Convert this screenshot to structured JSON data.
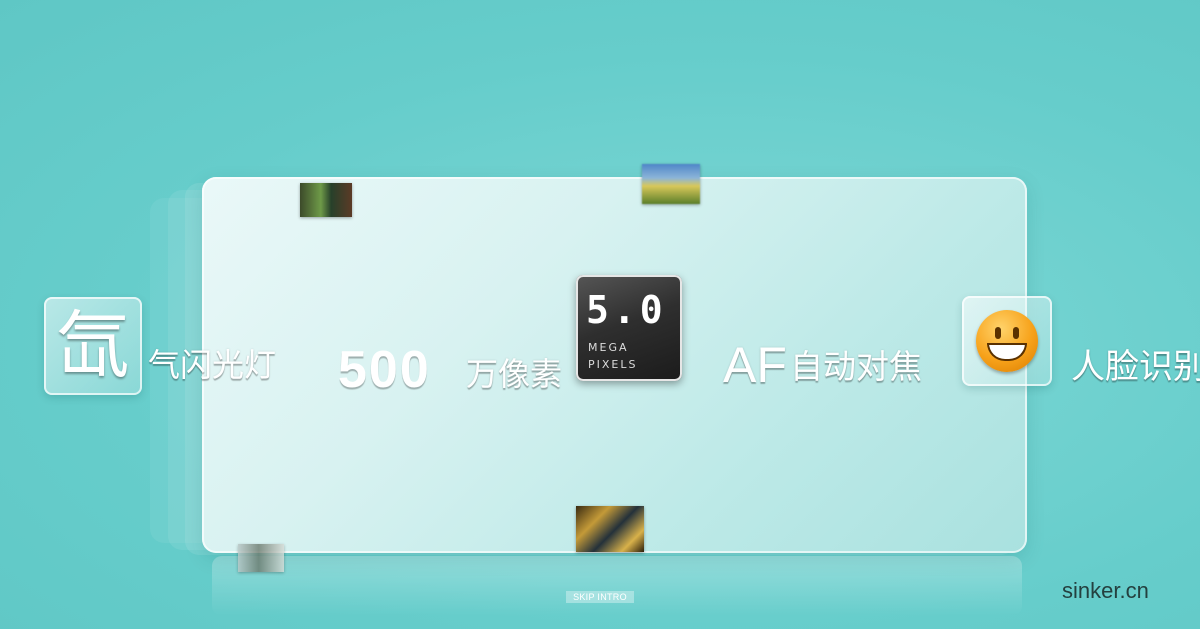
{
  "features": {
    "flash_icon_glyph": "氙",
    "flash_label": "气闪光灯",
    "pixels_number": "500",
    "pixels_label": "万像素",
    "af_label": "AF",
    "af_suffix": "自动对焦",
    "face_label": "人脸识别"
  },
  "mega_badge": {
    "number": "5.0",
    "line1": "MEGA",
    "line2": "PIXELS"
  },
  "icons": {
    "flash": "xenon-flash-icon",
    "face": "smiley-face-icon"
  },
  "skip_label": "SKIP INTRO",
  "watermark": "sinker.cn",
  "colors": {
    "background": "#66cdcb",
    "text": "#ffffff",
    "badge": "#2f2f2f",
    "smiley": "#f7a21a"
  }
}
